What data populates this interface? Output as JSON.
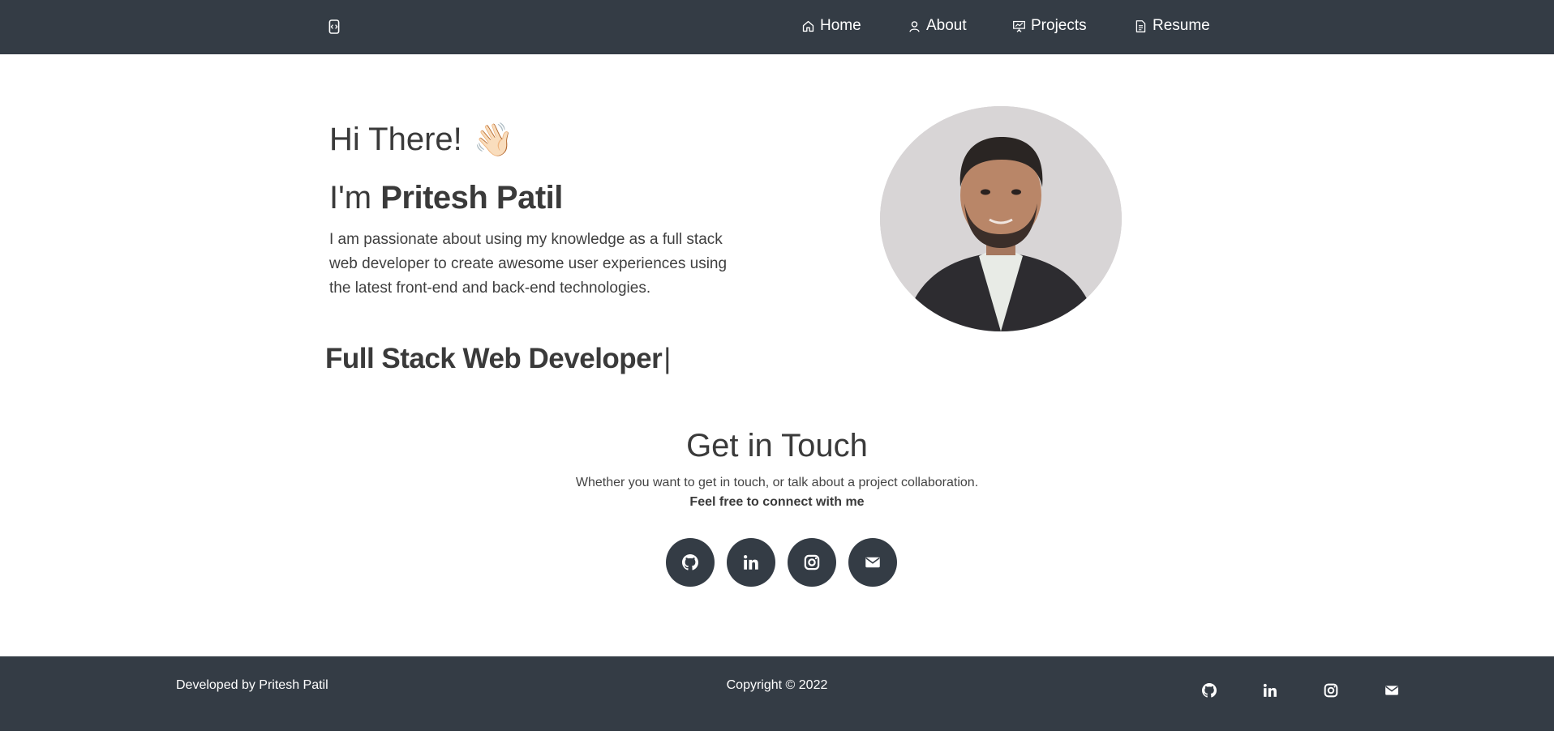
{
  "nav": {
    "brand_icon": "code-icon",
    "items": [
      {
        "label": "Home",
        "icon": "home-icon"
      },
      {
        "label": "About",
        "icon": "user-icon"
      },
      {
        "label": "Projects",
        "icon": "presentation-icon"
      },
      {
        "label": "Resume",
        "icon": "document-icon"
      }
    ]
  },
  "hero": {
    "greeting": "Hi There!",
    "wave_emoji": "👋🏻",
    "name_prefix": "I'm",
    "name": "Pritesh Patil",
    "description": "I am passionate about using my knowledge as a full stack web developer to create awesome user experiences using the latest front-end and back-end technologies.",
    "typewriter_text": "Full Stack Web Developer",
    "typewriter_cursor": "|"
  },
  "contact": {
    "title": "Get in Touch",
    "subtitle": "Whether you want to get in touch, or talk about a project collaboration.",
    "bold_line": "Feel free to connect with me",
    "socials": [
      "github-icon",
      "linkedin-icon",
      "instagram-icon",
      "email-icon"
    ]
  },
  "footer": {
    "left_text": "Developed by Pritesh Patil",
    "center_text": "Copyright © 2022"
  },
  "colors": {
    "navbar_bg": "#343c45",
    "text_primary": "#3a3a3a"
  }
}
